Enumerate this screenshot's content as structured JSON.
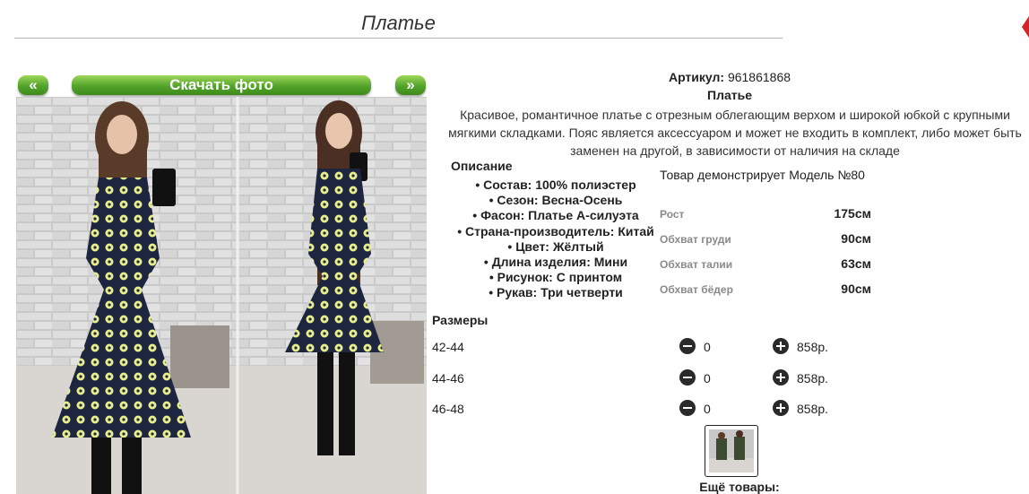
{
  "page": {
    "title": "Платье"
  },
  "nav": {
    "prev_label": "«",
    "download_label": "Скачать фото",
    "next_label": "»"
  },
  "product": {
    "sku_label": "Артикул:",
    "sku_value": "961861868",
    "name": "Платье",
    "description": "Красивое, романтичное платье с отрезным облегающим верхом и широкой юбкой с крупными мягкими складками. Пояс является аксессуаром и может не входить в комплект, либо может быть заменен на другой, в зависимости от наличия на складе",
    "description_heading": "Описание",
    "features": [
      "Состав: 100% полиэстер",
      "Сезон: Весна-Осень",
      "Фасон: Платье А-силуэта",
      "Страна-производитель: Китай",
      "Цвет: Жёлтый",
      "Длина изделия: Мини",
      "Рисунок: С принтом",
      "Рукав: Три четверти"
    ]
  },
  "model": {
    "caption": "Товар демонстрирует Модель №80",
    "measurements": [
      {
        "label": "Рост",
        "value": "175см"
      },
      {
        "label": "Обхват груди",
        "value": "90см"
      },
      {
        "label": "Обхват талии",
        "value": "63см"
      },
      {
        "label": "Обхват бёдер",
        "value": "90см"
      }
    ]
  },
  "sizes": {
    "heading": "Размеры",
    "rows": [
      {
        "size": "42-44",
        "qty": "0",
        "price": "858р."
      },
      {
        "size": "44-46",
        "qty": "0",
        "price": "858р."
      },
      {
        "size": "46-48",
        "qty": "0",
        "price": "858р."
      }
    ]
  },
  "more_goods_label": "Ещё товары:",
  "colors": {
    "button_green": "#52a32a",
    "dress_navy": "#1e2540",
    "dress_yellow": "#e8ef8a",
    "corner_red": "#d2232a"
  },
  "icons": {
    "minus": "minus-circle-icon",
    "plus": "plus-circle-icon"
  }
}
